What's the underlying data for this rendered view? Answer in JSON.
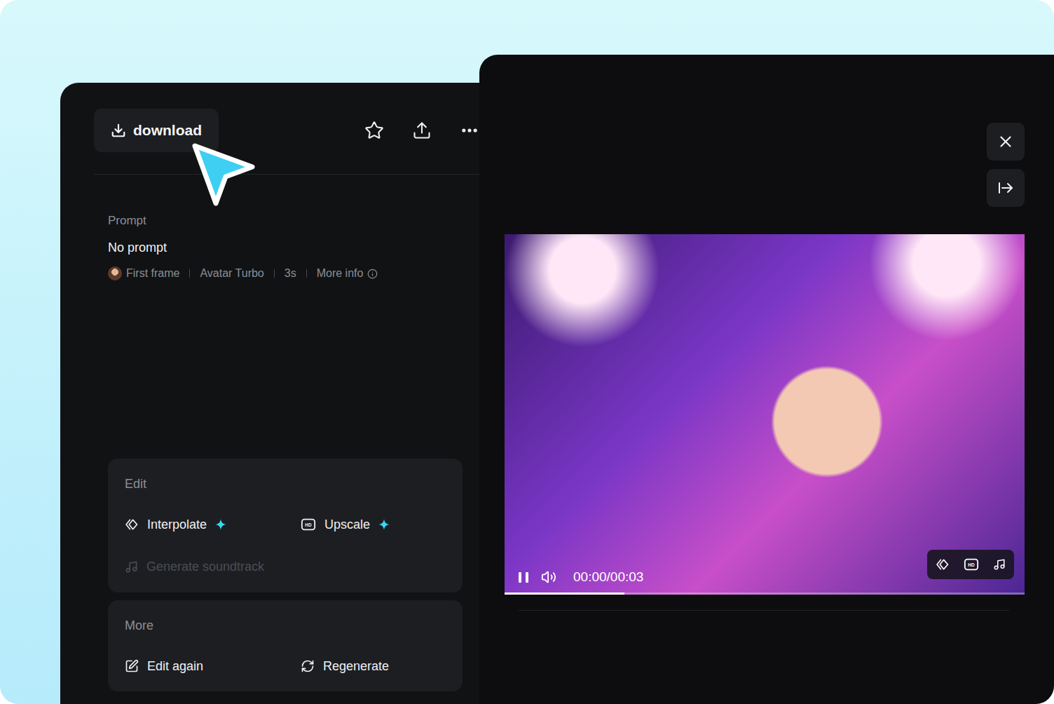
{
  "toolbar": {
    "download": "download"
  },
  "prompt": {
    "label": "Prompt",
    "value": "No prompt"
  },
  "meta": [
    {
      "label": "First frame",
      "kind": "thumbnail"
    },
    {
      "label": "Avatar Turbo",
      "kind": "text"
    },
    {
      "label": "3s",
      "kind": "text"
    },
    {
      "label": "More info",
      "kind": "info"
    }
  ],
  "edit": {
    "title": "Edit",
    "actions": [
      {
        "label": "Interpolate",
        "kind": "interpolate",
        "sparkle": true,
        "disabled": false
      },
      {
        "label": "Upscale",
        "kind": "upscale",
        "sparkle": true,
        "disabled": false
      },
      {
        "label": "Generate soundtrack",
        "kind": "soundtrack",
        "sparkle": false,
        "disabled": true
      }
    ]
  },
  "more": {
    "title": "More",
    "actions": [
      {
        "label": "Edit again",
        "kind": "edit"
      },
      {
        "label": "Regenerate",
        "kind": "regenerate"
      }
    ]
  },
  "hd_badge": "HD",
  "player": {
    "playing": true,
    "time": "00:00/00:03",
    "level": 0.23
  }
}
